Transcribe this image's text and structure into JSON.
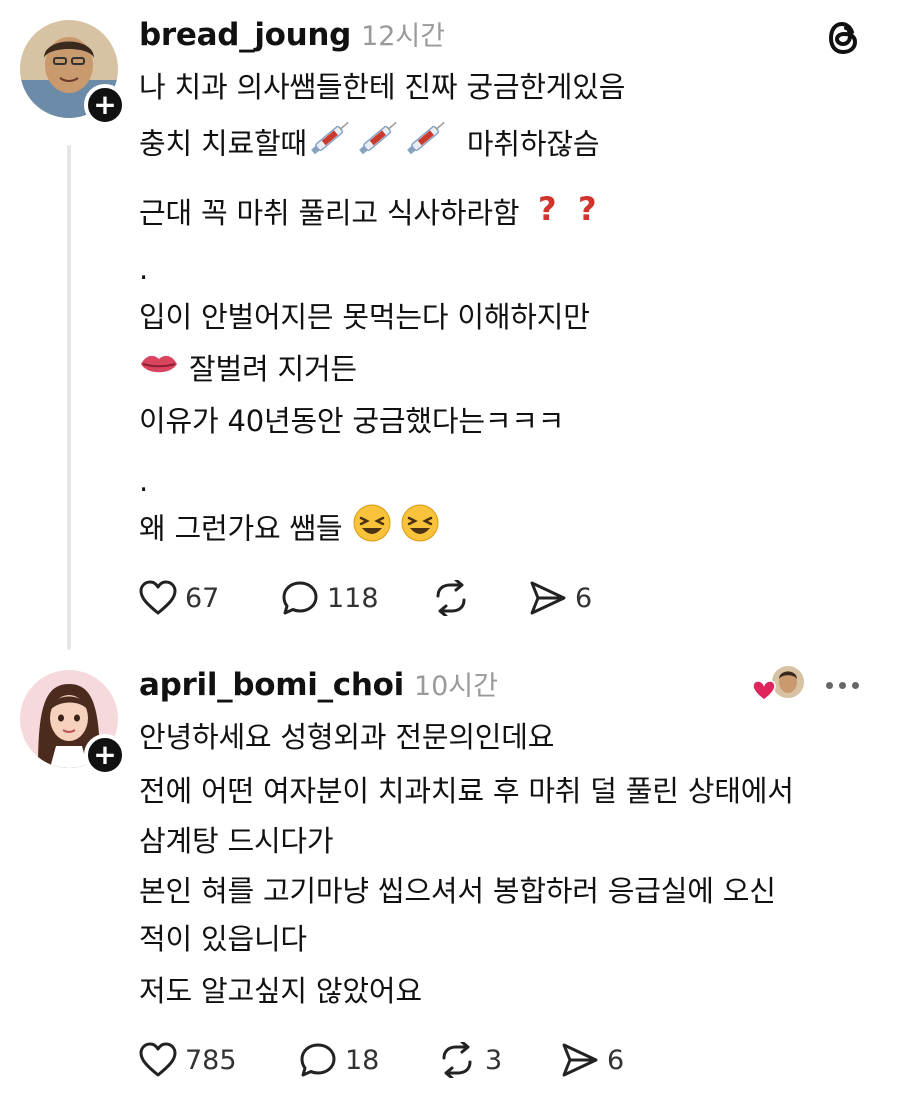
{
  "post1": {
    "username": "bread_joung",
    "time": "12시간",
    "lines": [
      "나 치과 의사쌤들한테  진짜 궁금한게있음",
      "충치 치료할때",
      "마취하잖슴",
      "근대 꼭 마취 풀리고 식사하라함",
      ".",
      "입이 안벌어지믄 못먹는다 이해하지만",
      "잘벌려  지거든",
      "이유가  40년동안  궁금했다는ㅋㅋㅋ",
      ".",
      "왜 그런가요 쌤들"
    ],
    "emojis": {
      "syringe": "💉",
      "question": "❓",
      "lips": "👄",
      "laugh": "😆"
    },
    "likes": "67",
    "replies": "118",
    "shares": "6"
  },
  "post2": {
    "username": "april_bomi_choi",
    "time": "10시간",
    "lines": [
      "안녕하세요 성형외과 전문의인데요",
      "전에 어떤 여자분이 치과치료 후 마취 덜 풀린 상태에서",
      "삼계탕 드시다가",
      "본인 혀를 고기마냥 씹으셔서 봉합하러 응급실에 오신",
      "적이 있읍니다",
      "저도 알고싶지 않았어요"
    ],
    "likes": "785",
    "replies": "18",
    "reposts": "3",
    "shares": "6"
  },
  "colors": {
    "time": "#9a9a9a",
    "thread_line": "#e6e6e6",
    "heart_red": "#e0245e",
    "question_red": "#d0342c"
  }
}
